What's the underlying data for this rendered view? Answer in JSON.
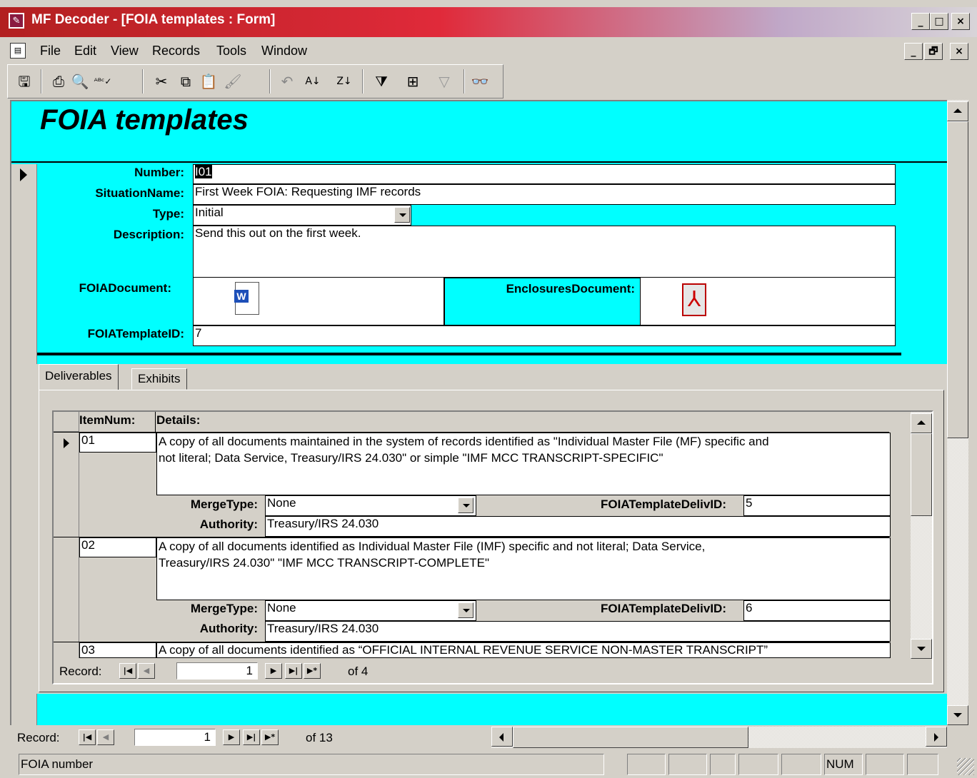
{
  "window": {
    "title": "MF Decoder - [FOIA templates : Form]",
    "controls": [
      "_",
      "□",
      "×"
    ],
    "doc_controls": [
      "_",
      "🗗",
      "×"
    ]
  },
  "menu": [
    "File",
    "Edit",
    "View",
    "Records",
    "Tools",
    "Window"
  ],
  "toolbar": {
    "buttons": [
      "save-icon",
      "print-icon",
      "print-preview-icon",
      "spelling-icon",
      "cut-icon",
      "copy-icon",
      "paste-icon",
      "format-painter-icon",
      "undo-icon",
      "sort-ascending-icon",
      "sort-descending-icon",
      "filter-by-selection-icon",
      "filter-by-form-icon",
      "apply-filter-icon",
      "find-icon"
    ]
  },
  "form": {
    "title": "FOIA templates",
    "labels": {
      "number": "Number:",
      "situation": "SituationName:",
      "type": "Type:",
      "description": "Description:",
      "foia_document": "FOIADocument:",
      "enclosures_document": "EnclosuresDocument:",
      "template_id": "FOIATemplateID:"
    },
    "values": {
      "number": "I01",
      "situation": "First Week FOIA:  Requesting IMF records",
      "type": "Initial",
      "description": "Send this out on the first week.",
      "template_id": "7"
    },
    "tabs": [
      "Deliverables",
      "Exhibits"
    ]
  },
  "subform": {
    "headers": {
      "item": "ItemNum:",
      "details": "Details:"
    },
    "labels": {
      "merge": "MergeType:",
      "deliv_id": "FOIATemplateDelivID:",
      "authority": "Authority:"
    },
    "rows": [
      {
        "item": "01",
        "details_1": "A copy of all documents maintained in the system of records identified as \"Individual Master File (MF) specific and",
        "details_2": "not literal; Data Service, Treasury/IRS 24.030\" or simple \"IMF MCC TRANSCRIPT-SPECIFIC\"",
        "merge": "None",
        "deliv_id": "5",
        "authority": "Treasury/IRS 24.030"
      },
      {
        "item": "02",
        "details_1": "A copy of all documents identified as Individual Master File (IMF) specific and not literal; Data Service,",
        "details_2": "Treasury/IRS 24.030\" \"IMF MCC TRANSCRIPT-COMPLETE\"",
        "merge": "None",
        "deliv_id": "6",
        "authority": "Treasury/IRS 24.030"
      },
      {
        "item": "03",
        "details_1": "A copy of all documents identified as “OFFICIAL INTERNAL REVENUE SERVICE NON-MASTER TRANSCRIPT”"
      }
    ],
    "nav": {
      "label": "Record:",
      "current": "1",
      "of": "of  4"
    }
  },
  "main_nav": {
    "label": "Record:",
    "current": "1",
    "of": "of  13"
  },
  "status": {
    "text": "FOIA number",
    "num": "NUM"
  }
}
